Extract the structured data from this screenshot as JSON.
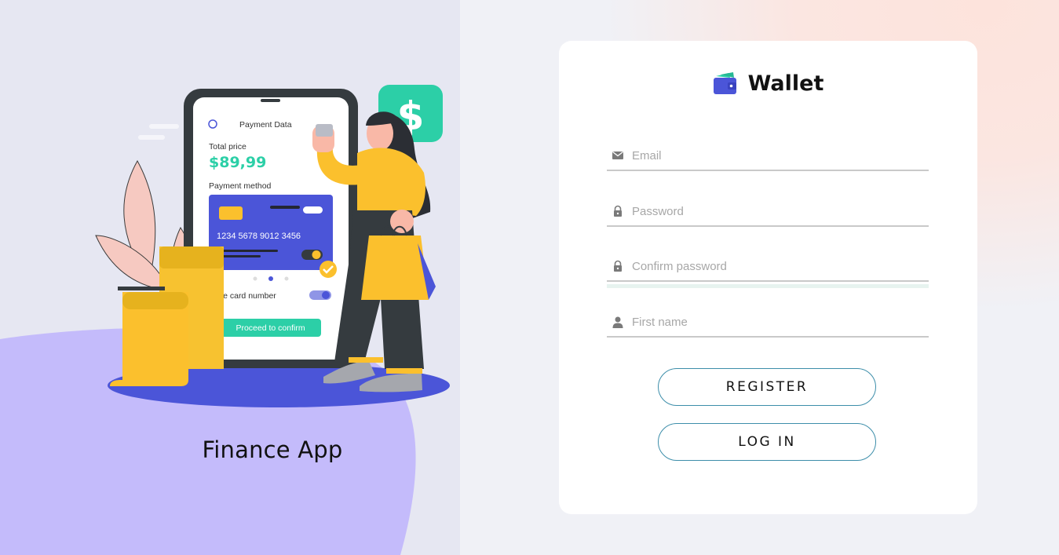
{
  "left": {
    "tagline": "Finance App",
    "illustration": {
      "phone_header": "Payment Data",
      "total_label": "Total price",
      "total_value": "$89,99",
      "method_label": "Payment method",
      "card_number": "1234  5678  9012  3456",
      "save_label": "Save card number",
      "proceed_label": "Proceed to confirm",
      "dollar_symbol": "$"
    }
  },
  "card": {
    "brand_name": "Wallet",
    "brand_icon": "wallet-icon",
    "fields": {
      "email": {
        "placeholder": "Email",
        "value": "",
        "icon": "mail-icon"
      },
      "password": {
        "placeholder": "Password",
        "value": "",
        "icon": "lock-icon"
      },
      "confirm_password": {
        "placeholder": "Confirm password",
        "value": "",
        "icon": "lock-icon"
      },
      "first_name": {
        "placeholder": "First name",
        "value": "",
        "icon": "person-icon"
      }
    },
    "register_label": "REGISTER",
    "login_label": "LOG IN"
  },
  "colors": {
    "accent_blue": "#4b55d8",
    "accent_green": "#2ccfa7",
    "accent_yellow": "#fbc02d",
    "blob_purple": "#c4bbfb",
    "button_border": "#3d8eaa"
  }
}
